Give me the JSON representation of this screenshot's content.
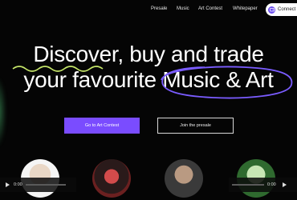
{
  "nav": {
    "links": [
      "Presale",
      "Music",
      "Art Contest",
      "Whitepaper"
    ],
    "connect_label": "Connect",
    "connect_icon": "wallet-icon"
  },
  "hero": {
    "line1": "Discover, buy and trade",
    "line1_highlight": "Discover",
    "line2_pre": "your favourite ",
    "line2_highlight": "Music & Art",
    "accent_squiggle_color": "#c7e86a",
    "accent_ellipse_color": "#7a5cff"
  },
  "buttons": {
    "primary_label": "Go to Art Contest",
    "secondary_label": "Join the presale",
    "primary_color": "#7a4cff"
  },
  "player": {
    "current_time": "0:00",
    "duration": "0:00",
    "progress": 0
  },
  "colors": {
    "background": "#050505",
    "text": "#ffffff"
  }
}
